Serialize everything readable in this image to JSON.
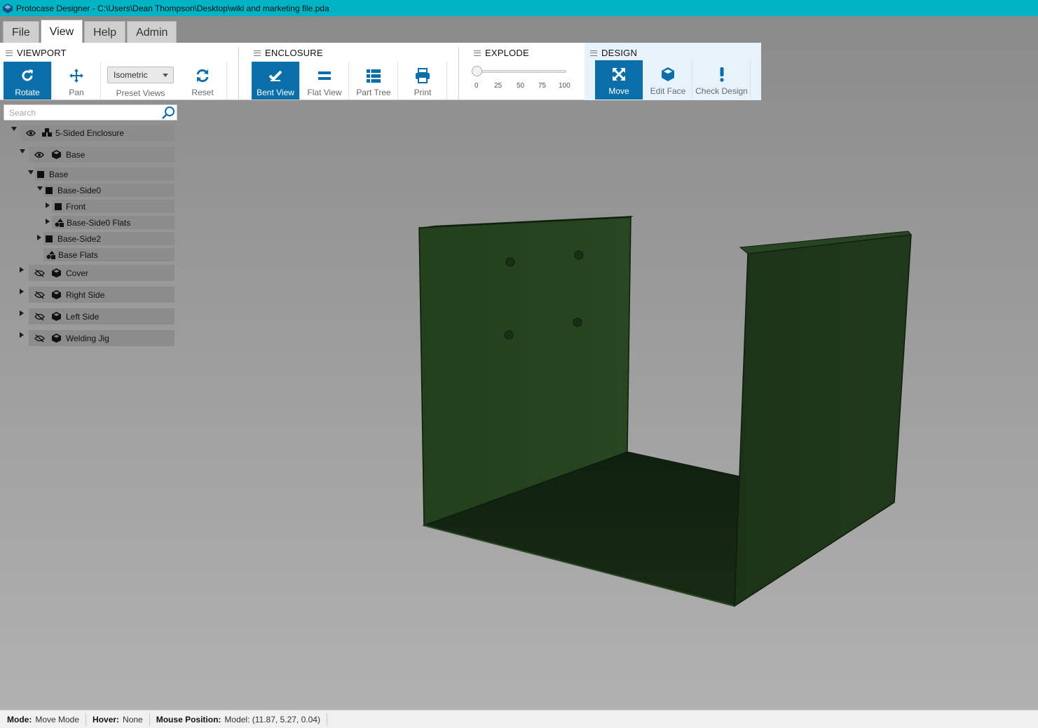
{
  "window": {
    "title": "Protocase Designer - C:\\Users\\Dean Thompson\\Desktop\\wiki and marketing file.pda"
  },
  "menu": {
    "tabs": [
      "File",
      "View",
      "Help",
      "Admin"
    ],
    "active": "View"
  },
  "ribbon": {
    "viewport": {
      "header": "VIEWPORT",
      "rotate": "Rotate",
      "pan": "Pan",
      "preset_value": "Isometric",
      "preset_label": "Preset Views",
      "reset": "Reset"
    },
    "enclosure": {
      "header": "ENCLOSURE",
      "bent_view": "Bent View",
      "flat_view": "Flat View",
      "part_tree": "Part Tree",
      "print": "Print"
    },
    "explode": {
      "header": "EXPLODE",
      "ticks": [
        "0",
        "25",
        "50",
        "75",
        "100"
      ],
      "value": 0
    },
    "design": {
      "header": "DESIGN",
      "move": "Move",
      "edit_face": "Edit Face",
      "check_design": "Check Design"
    }
  },
  "search": {
    "placeholder": "Search"
  },
  "tree": {
    "items": [
      {
        "label": "5-Sided Enclosure",
        "visible": true
      },
      {
        "label": "Base",
        "visible": true
      },
      {
        "label": "Base"
      },
      {
        "label": "Base-Side0"
      },
      {
        "label": "Front"
      },
      {
        "label": "Base-Side0 Flats"
      },
      {
        "label": "Base-Side2"
      },
      {
        "label": "Base Flats"
      },
      {
        "label": "Cover",
        "visible": false
      },
      {
        "label": "Right Side",
        "visible": false
      },
      {
        "label": "Left Side",
        "visible": false
      },
      {
        "label": "Welding Jig",
        "visible": false
      }
    ]
  },
  "status": {
    "mode_key": "Mode:",
    "mode_val": "Move Mode",
    "hover_key": "Hover:",
    "hover_val": "None",
    "pos_key": "Mouse Position:",
    "pos_val": "Model: (11.87, 5.27, 0.04)"
  },
  "colors": {
    "titlebar": "#00b4c6",
    "accent": "#0a6ea8",
    "part_green": "#23401c"
  }
}
